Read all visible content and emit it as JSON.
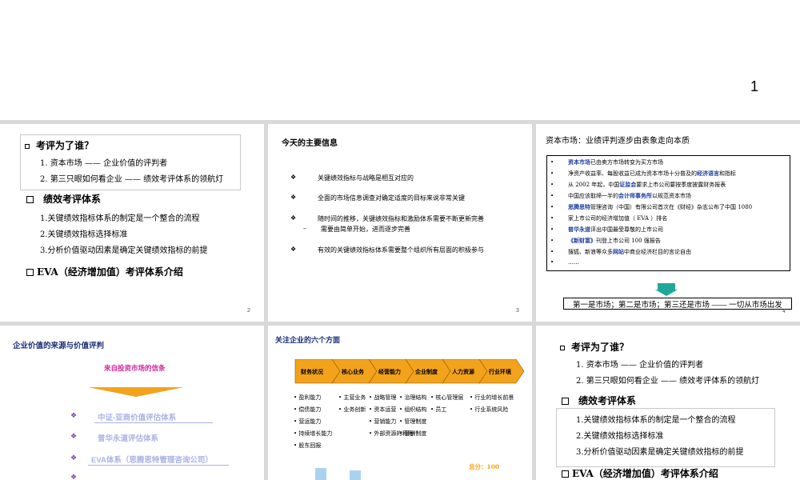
{
  "s1": {
    "page": "1"
  },
  "s2": {
    "heading1": "考评为了谁？",
    "items1": [
      "1. 资本市场 —— 企业价值的评判者",
      "2. 第三只眼如何看企业 —— 绩效考评体系的领航灯"
    ],
    "heading2": "绩效考评体系",
    "items2": [
      "1.关键绩效指标体系的制定是一个整合的流程",
      "2.关键绩效指标选择标准",
      "3.分析价值驱动因素是确定关键绩效指标的前提"
    ],
    "heading3": "EVA（经济增加值）考评体系介绍",
    "page": "2"
  },
  "s3": {
    "title": "今天的主要信息",
    "bullets": [
      "关键绩效指标与战略是相互对应的",
      "全面的市场信息调查对确定适度的目标来说非常关键",
      "随时间的推移，关键绩效指标和激励体系需要不断更新完善",
      "需要由简单开始，进而逐步完善",
      "有效的关键绩效指标体系需要整个组织所有层面的积极参与"
    ],
    "dash": "–",
    "page": "3"
  },
  "s4": {
    "title": "资本市场：业绩评判逐步由表象走向本质",
    "lines": [
      {
        "hl": "资本市场",
        "text": "已由卖方市场转变为买方市场"
      },
      {
        "hl": "",
        "text": "净资产收益率、每股收益已成为资本市场十分普及的",
        "hl2": "经济语言",
        "tail": "和指标"
      },
      {
        "hl": "",
        "text": "从 2002 年起，中国",
        "hl2": "证监会",
        "tail": "要求上市公司要按季度披露财务报表"
      },
      {
        "hl": "",
        "text": "中国应该取缔一半的",
        "hl2": "会计师事务所",
        "tail": "以规范资本市场"
      },
      {
        "hl": "思腾思特",
        "text": "管理咨询（中国）有限公司首次在《财经》杂志公布了中国 1080"
      },
      {
        "hl": "",
        "text": "家上市公司的经济增加值（ EVA ）排名"
      },
      {
        "hl": "普华永道",
        "text": "评出中国最受尊敬的上市公司"
      },
      {
        "hl": "《新财富》",
        "text": "刊登上市公司 100 强报告"
      },
      {
        "hl": "",
        "text": "搜狐、新浪等众多",
        "hl2": "网站",
        "tail": "中商业经济栏目的言论自由"
      },
      {
        "hl": "",
        "text": "……"
      }
    ],
    "conclusion": "第一是市场；第二是市场；第三还是市场 —— 一切从市场出发",
    "page": "4"
  },
  "s5": {
    "title": "企业价值的来源与价值评判",
    "subtitle": "来自投资市场的信条",
    "items": [
      "中证-亚商价值评估体系",
      "普华永道评估体系",
      "EVA体系（思腾思特管理咨询公司）"
    ]
  },
  "s6": {
    "title": "关注企业的六个方面",
    "steps": [
      "财务状况",
      "核心业务",
      "经营能力",
      "企业制度",
      "人力资源",
      "行业环境"
    ],
    "cols": [
      [
        "盈利能力",
        "偿债能力",
        "营运能力",
        "持续增长能力",
        "股东回报"
      ],
      [
        "主营业务",
        "业务创新"
      ],
      [
        "战略管理",
        "资本运营",
        "营销能力",
        "外部资源的利用"
      ],
      [
        "治理结构",
        "组织结构",
        "管理制度",
        "薪酬制度"
      ],
      [
        "核心管理层",
        "员工"
      ],
      [
        "行业的增长前景",
        "行业系统风险"
      ]
    ],
    "total": "总分：100",
    "bar_labels": [
      "",
      ""
    ]
  },
  "s7": {
    "heading1": "考评为了谁？",
    "items1": [
      "1. 资本市场 —— 企业价值的评判者",
      "2. 第三只眼如何看企业 —— 绩效考评体系的领航灯"
    ],
    "heading2": "绩效考评体系",
    "items2": [
      "1.关键绩效指标体系的制定是一个整合的流程",
      "2.关键绩效指标选择标准",
      "3.分析价值驱动因素是确定关键绩效指标的前提"
    ],
    "heading3": "EVA（经济增加值）考评体系介绍"
  }
}
